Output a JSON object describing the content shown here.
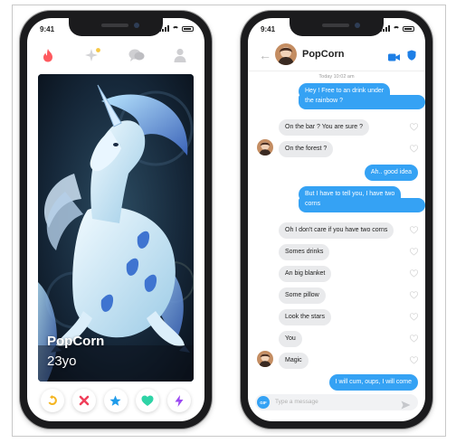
{
  "left_phone": {
    "status": {
      "time": "9:41"
    },
    "profile": {
      "name": "PopCorn",
      "age": "23yo"
    }
  },
  "right_phone": {
    "status": {
      "time": "9:41"
    },
    "header": {
      "title": "PopCorn"
    },
    "timestamp": "Today 10:02 am",
    "messages": [
      {
        "dir": "out",
        "text": "Hey ! Free to an drink under"
      },
      {
        "dir": "out",
        "text": "the rainbow ?"
      },
      {
        "dir": "in",
        "text": "On the bar ? You are sure ?"
      },
      {
        "dir": "in",
        "text": "On the forest ?"
      },
      {
        "dir": "out",
        "text": "Ah.. good idea"
      },
      {
        "dir": "out",
        "text": "But I have to tell you, I have two"
      },
      {
        "dir": "out",
        "text": "corns"
      },
      {
        "dir": "in",
        "text": "Oh I don't care if you have two corns"
      },
      {
        "dir": "in",
        "text": "Somes drinks"
      },
      {
        "dir": "in",
        "text": "An big blanket"
      },
      {
        "dir": "in",
        "text": "Some pillow"
      },
      {
        "dir": "in",
        "text": "Look the stars"
      },
      {
        "dir": "in",
        "text": "You"
      },
      {
        "dir": "in",
        "text": "Magic"
      },
      {
        "dir": "out",
        "text": "I will cum, oups, I will come"
      }
    ],
    "composer": {
      "gif": "GIF",
      "placeholder": "Type a message"
    }
  },
  "colors": {
    "accent": "#35a2f4",
    "tinder": "#fe5a5f",
    "like": "#2fd3a6",
    "superlike": "#1e9bea",
    "boost": "#9b48f2",
    "rewind": "#f4b521",
    "nope": "#f0405b"
  },
  "icons": [
    "flame-icon",
    "sparkle-icon",
    "chat-bubbles-icon",
    "profile-icon",
    "rewind-icon",
    "nope-icon",
    "superlike-star-icon",
    "like-heart-icon",
    "boost-bolt-icon",
    "back-icon",
    "video-icon",
    "shield-icon",
    "send-icon"
  ]
}
